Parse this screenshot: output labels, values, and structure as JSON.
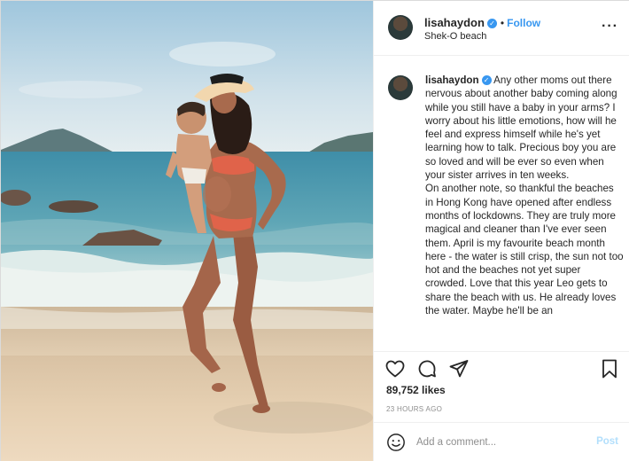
{
  "post": {
    "username": "lisahaydon",
    "verified": true,
    "follow_label": "Follow",
    "follow_separator": "•",
    "location": "Shek-O beach",
    "more_icon": "more-horizontal-icon",
    "caption": "Any other moms out there nervous about another baby coming along while you still have a baby in your arms? I worry about his little emotions, how will he feel and express himself while he's yet learning how to talk. Precious boy you are so loved and will be ever so even when your sister arrives in ten weeks.\nOn another note, so thankful the beaches in Hong Kong have opened after endless months of lockdowns. They are truly more magical and cleaner than I've ever seen them. April is my favourite beach month here - the water is still crisp, the sun not too hot and the beaches not yet super crowded. Love that this year Leo gets to share the beach with us. He already loves the water. Maybe he'll be an",
    "likes": "89,752 likes",
    "time": "23 HOURS AGO"
  },
  "actions": {
    "like_icon": "heart-icon",
    "comment_icon": "comment-icon",
    "share_icon": "share-icon",
    "save_icon": "bookmark-icon"
  },
  "comment_box": {
    "emoji_icon": "smiley-icon",
    "placeholder": "Add a comment...",
    "post_label": "Post"
  },
  "colors": {
    "link_blue": "#3897f0",
    "post_disabled": "#b2dffc",
    "muted_text": "#8e8e8e",
    "border": "#efefef"
  }
}
